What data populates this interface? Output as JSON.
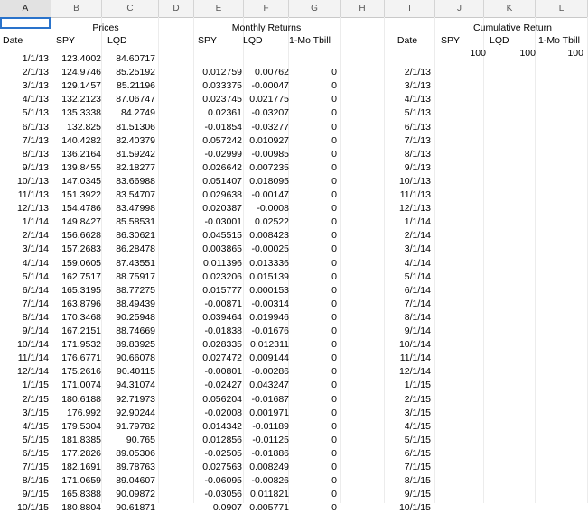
{
  "columns": [
    "A",
    "B",
    "C",
    "D",
    "E",
    "F",
    "G",
    "H",
    "I",
    "J",
    "K",
    "L"
  ],
  "headers": {
    "prices": "Prices",
    "monthly_returns": "Monthly Returns",
    "cumulative_return": "Cumulative Return",
    "date": "Date",
    "spy": "SPY",
    "lqd": "LQD",
    "tbill": "1-Mo Tbill",
    "date2": "Date",
    "spy2": "SPY",
    "lqd2": "LQD",
    "tbill2": "1-Mo Tbill"
  },
  "cumulative_start": [
    "100",
    "100",
    "100"
  ],
  "rows": [
    [
      "1/1/13",
      "123.4002",
      "84.60717",
      "",
      "",
      "",
      ""
    ],
    [
      "2/1/13",
      "124.9746",
      "85.25192",
      "0.012759",
      "0.00762",
      "0",
      "2/1/13"
    ],
    [
      "3/1/13",
      "129.1457",
      "85.21196",
      "0.033375",
      "-0.00047",
      "0",
      "3/1/13"
    ],
    [
      "4/1/13",
      "132.2123",
      "87.06747",
      "0.023745",
      "0.021775",
      "0",
      "4/1/13"
    ],
    [
      "5/1/13",
      "135.3338",
      "84.2749",
      "0.02361",
      "-0.03207",
      "0",
      "5/1/13"
    ],
    [
      "6/1/13",
      "132.825",
      "81.51306",
      "-0.01854",
      "-0.03277",
      "0",
      "6/1/13"
    ],
    [
      "7/1/13",
      "140.4282",
      "82.40379",
      "0.057242",
      "0.010927",
      "0",
      "7/1/13"
    ],
    [
      "8/1/13",
      "136.2164",
      "81.59242",
      "-0.02999",
      "-0.00985",
      "0",
      "8/1/13"
    ],
    [
      "9/1/13",
      "139.8455",
      "82.18277",
      "0.026642",
      "0.007235",
      "0",
      "9/1/13"
    ],
    [
      "10/1/13",
      "147.0345",
      "83.66988",
      "0.051407",
      "0.018095",
      "0",
      "10/1/13"
    ],
    [
      "11/1/13",
      "151.3922",
      "83.54707",
      "0.029638",
      "-0.00147",
      "0",
      "11/1/13"
    ],
    [
      "12/1/13",
      "154.4786",
      "83.47998",
      "0.020387",
      "-0.0008",
      "0",
      "12/1/13"
    ],
    [
      "1/1/14",
      "149.8427",
      "85.58531",
      "-0.03001",
      "0.02522",
      "0",
      "1/1/14"
    ],
    [
      "2/1/14",
      "156.6628",
      "86.30621",
      "0.045515",
      "0.008423",
      "0",
      "2/1/14"
    ],
    [
      "3/1/14",
      "157.2683",
      "86.28478",
      "0.003865",
      "-0.00025",
      "0",
      "3/1/14"
    ],
    [
      "4/1/14",
      "159.0605",
      "87.43551",
      "0.011396",
      "0.013336",
      "0",
      "4/1/14"
    ],
    [
      "5/1/14",
      "162.7517",
      "88.75917",
      "0.023206",
      "0.015139",
      "0",
      "5/1/14"
    ],
    [
      "6/1/14",
      "165.3195",
      "88.77275",
      "0.015777",
      "0.000153",
      "0",
      "6/1/14"
    ],
    [
      "7/1/14",
      "163.8796",
      "88.49439",
      "-0.00871",
      "-0.00314",
      "0",
      "7/1/14"
    ],
    [
      "8/1/14",
      "170.3468",
      "90.25948",
      "0.039464",
      "0.019946",
      "0",
      "8/1/14"
    ],
    [
      "9/1/14",
      "167.2151",
      "88.74669",
      "-0.01838",
      "-0.01676",
      "0",
      "9/1/14"
    ],
    [
      "10/1/14",
      "171.9532",
      "89.83925",
      "0.028335",
      "0.012311",
      "0",
      "10/1/14"
    ],
    [
      "11/1/14",
      "176.6771",
      "90.66078",
      "0.027472",
      "0.009144",
      "0",
      "11/1/14"
    ],
    [
      "12/1/14",
      "175.2616",
      "90.40115",
      "-0.00801",
      "-0.00286",
      "0",
      "12/1/14"
    ],
    [
      "1/1/15",
      "171.0074",
      "94.31074",
      "-0.02427",
      "0.043247",
      "0",
      "1/1/15"
    ],
    [
      "2/1/15",
      "180.6188",
      "92.71973",
      "0.056204",
      "-0.01687",
      "0",
      "2/1/15"
    ],
    [
      "3/1/15",
      "176.992",
      "92.90244",
      "-0.02008",
      "0.001971",
      "0",
      "3/1/15"
    ],
    [
      "4/1/15",
      "179.5304",
      "91.79782",
      "0.014342",
      "-0.01189",
      "0",
      "4/1/15"
    ],
    [
      "5/1/15",
      "181.8385",
      "90.765",
      "0.012856",
      "-0.01125",
      "0",
      "5/1/15"
    ],
    [
      "6/1/15",
      "177.2826",
      "89.05306",
      "-0.02505",
      "-0.01886",
      "0",
      "6/1/15"
    ],
    [
      "7/1/15",
      "182.1691",
      "89.78763",
      "0.027563",
      "0.008249",
      "0",
      "7/1/15"
    ],
    [
      "8/1/15",
      "171.0659",
      "89.04607",
      "-0.06095",
      "-0.00826",
      "0",
      "8/1/15"
    ],
    [
      "9/1/15",
      "165.8388",
      "90.09872",
      "-0.03056",
      "0.011821",
      "0",
      "9/1/15"
    ],
    [
      "10/1/15",
      "180.8804",
      "90.61871",
      "0.0907",
      "0.005771",
      "0",
      "10/1/15"
    ]
  ]
}
